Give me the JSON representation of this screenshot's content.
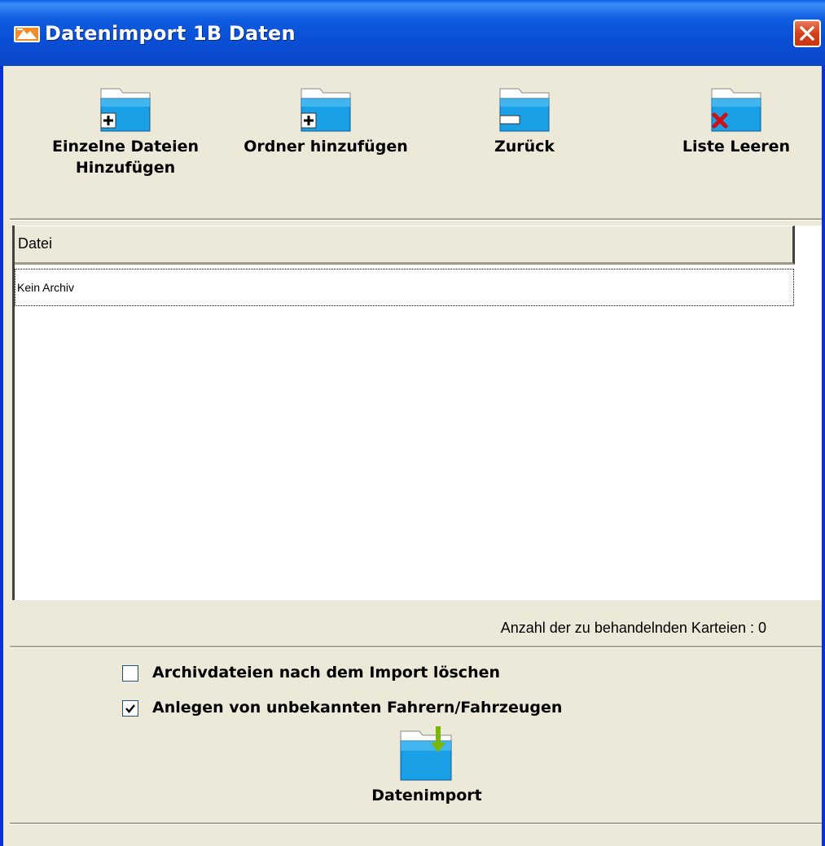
{
  "window": {
    "title": "Datenimport 1B Daten",
    "app_icon": "app-logo-icon",
    "close_icon": "close-icon"
  },
  "toolbar": {
    "add_files": {
      "label": "Einzelne Dateien\nHinzufügen",
      "icon": "folder-plus-icon"
    },
    "add_folder": {
      "label": "Ordner hinzufügen",
      "icon": "folder-plus-icon"
    },
    "back": {
      "label": "Zurück",
      "icon": "folder-minus-icon"
    },
    "clear_list": {
      "label": "Liste Leeren",
      "icon": "folder-x-icon"
    }
  },
  "file_list": {
    "columns": [
      "Datei"
    ],
    "rows": [
      {
        "file": "Kein Archiv"
      }
    ]
  },
  "status": {
    "count_text": "Anzahl der zu behandelnden Karteien : 0"
  },
  "options": {
    "delete_archives": {
      "label": "Archivdateien nach dem Import löschen",
      "checked": false
    },
    "create_unknown": {
      "label": "Anlegen von unbekannten Fahrern/Fahrzeugen",
      "checked": true
    }
  },
  "import_button": {
    "label": "Datenimport",
    "icon": "folder-download-icon"
  },
  "colors": {
    "titlebar": "#0a4fd6",
    "window_bg": "#ece9d8",
    "folder_blue": "#1aa0e6",
    "close_red": "#d6401d",
    "arrow_green": "#7ab800",
    "x_red": "#d01010"
  }
}
